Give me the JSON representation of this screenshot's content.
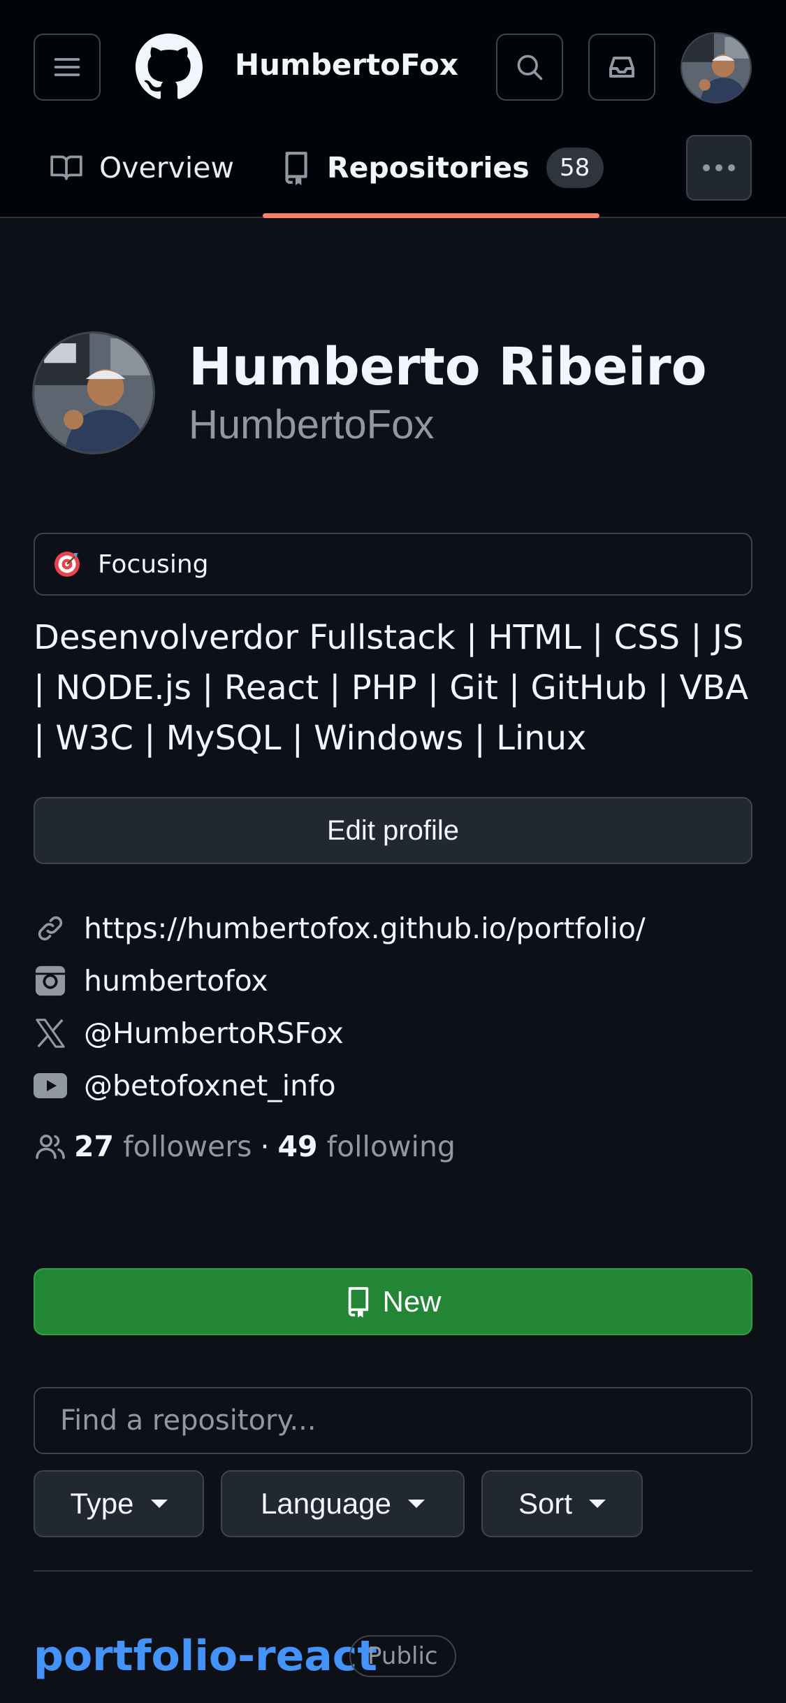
{
  "header": {
    "username": "HumbertoFox",
    "icons": {
      "menu": "hamburger-icon",
      "logo": "github-logo",
      "search": "search-icon",
      "inbox": "inbox-icon"
    }
  },
  "tabs": {
    "overview_label": "Overview",
    "repositories_label": "Repositories",
    "repositories_count": "58",
    "active": "repositories"
  },
  "profile": {
    "full_name": "Humberto Ribeiro",
    "login": "HumbertoFox",
    "status": {
      "emoji": "direct-hit-icon",
      "text": "Focusing"
    },
    "bio": "Desenvolverdor Fullstack | HTML | CSS | JS | NODE.js | React | PHP | Git | GitHub | VBA | W3C | MySQL | Windows | Linux",
    "edit_label": "Edit profile",
    "links": {
      "website": "https://humbertofox.github.io/portfolio/",
      "instagram": "humbertofox",
      "x": "@HumbertoRSFox",
      "youtube": "@betofoxnet_info"
    },
    "followers_count": "27",
    "followers_label": "followers",
    "separator": "·",
    "following_count": "49",
    "following_label": "following"
  },
  "repos": {
    "new_label": "New",
    "search_placeholder": "Find a repository...",
    "filters": {
      "type": "Type",
      "language": "Language",
      "sort": "Sort"
    },
    "items": [
      {
        "name": "portfolio-react",
        "visibility": "Public"
      }
    ]
  },
  "colors": {
    "background": "#0d1117",
    "header_bg": "#010409",
    "accent_underline": "#f78166",
    "new_button": "#238636",
    "link": "#4493f8"
  }
}
